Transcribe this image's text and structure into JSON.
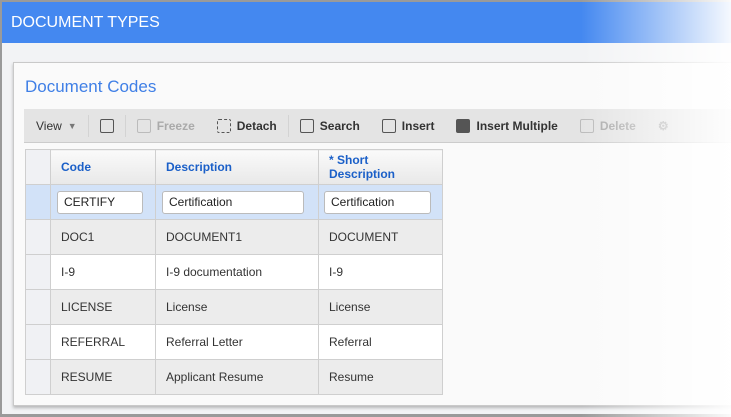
{
  "header": {
    "title": "DOCUMENT TYPES"
  },
  "panel": {
    "title": "Document Codes"
  },
  "toolbar": {
    "view": "View",
    "freeze": "Freeze",
    "detach": "Detach",
    "search": "Search",
    "insert": "Insert",
    "insert_multiple": "Insert Multiple",
    "delete": "Delete"
  },
  "table": {
    "headers": [
      "Code",
      "Description",
      "* Short Description"
    ],
    "edit_row": {
      "code": "CERTIFY",
      "description": "Certification",
      "short": "Certification"
    },
    "rows": [
      [
        "DOC1",
        "DOCUMENT1",
        "DOCUMENT"
      ],
      [
        "I-9",
        "I-9 documentation",
        "I-9"
      ],
      [
        "LICENSE",
        "License",
        "License"
      ],
      [
        "REFERRAL",
        "Referral Letter",
        "Referral"
      ],
      [
        "RESUME",
        "Applicant Resume",
        "Resume"
      ]
    ]
  }
}
